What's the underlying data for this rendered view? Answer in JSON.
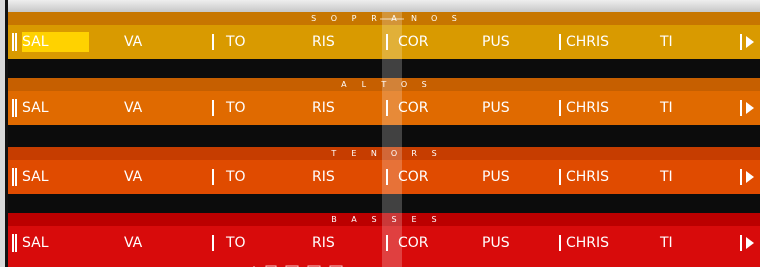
{
  "tracks": [
    {
      "name": "SOPRANOS",
      "title_letters": [
        "S",
        "O",
        "P",
        "R",
        "A",
        "N",
        "O",
        "S"
      ],
      "bg": "#d99a00",
      "header_bg": "#c77600",
      "syllables": [
        "SAL",
        "VA",
        "TO",
        "RIS",
        "COR",
        "PUS",
        "CHRIS",
        "TI"
      ],
      "active_index": 0
    },
    {
      "name": "ALTOS",
      "title_letters": [
        "A",
        "L",
        "T",
        "O",
        "S"
      ],
      "bg": "#e06a00",
      "header_bg": "#c65f00",
      "syllables": [
        "SAL",
        "VA",
        "TO",
        "RIS",
        "COR",
        "PUS",
        "CHRIS",
        "TI"
      ],
      "active_index": -1
    },
    {
      "name": "TENORS",
      "title_letters": [
        "T",
        "E",
        "N",
        "O",
        "R",
        "S"
      ],
      "bg": "#e04b00",
      "header_bg": "#c63d00",
      "syllables": [
        "SAL",
        "VA",
        "TO",
        "RIS",
        "COR",
        "PUS",
        "CHRIS",
        "TI"
      ],
      "active_index": -1
    },
    {
      "name": "BASSES",
      "title_letters": [
        "B",
        "A",
        "S",
        "S",
        "E",
        "S"
      ],
      "bg": "#d80b0b",
      "header_bg": "#bb0000",
      "syllables": [
        "SAL",
        "VA",
        "TO",
        "RIS",
        "COR",
        "PUS",
        "CHRIS",
        "TI"
      ],
      "active_index": -1
    }
  ],
  "colors": {
    "active_syllable": "#ffd200",
    "text": "#ffffff"
  }
}
